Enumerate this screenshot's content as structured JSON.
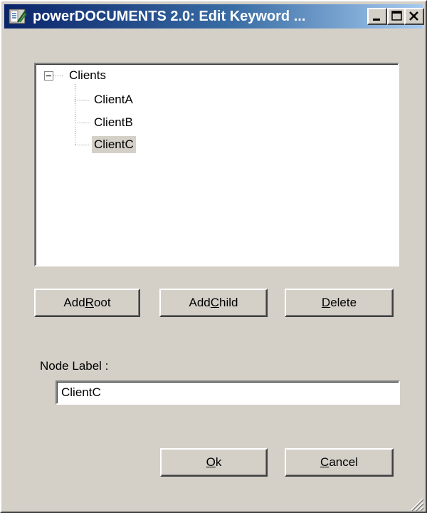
{
  "window": {
    "title": "powerDOCUMENTS 2.0: Edit Keyword ...",
    "caption_buttons": {
      "minimize_icon": "minimize-icon",
      "maximize_icon": "maximize-icon",
      "close_icon": "close-icon"
    }
  },
  "tree": {
    "root": {
      "label": "Clients",
      "expanded": true,
      "expander_glyph": "⊟"
    },
    "children": [
      {
        "label": "ClientA",
        "selected": false
      },
      {
        "label": "ClientB",
        "selected": false
      },
      {
        "label": "ClientC",
        "selected": true
      }
    ]
  },
  "buttons": {
    "add_root": {
      "pre": "Add",
      "mnemonic": "R",
      "post": "oot"
    },
    "add_child": {
      "pre": "Add",
      "mnemonic": "C",
      "post": "hild"
    },
    "delete": {
      "pre": "",
      "mnemonic": "D",
      "post": "elete"
    },
    "ok": {
      "pre": "",
      "mnemonic": "O",
      "post": "k"
    },
    "cancel": {
      "pre": "",
      "mnemonic": "C",
      "post": "ancel"
    }
  },
  "node_label": {
    "caption": "Node Label :",
    "value": "ClientC"
  },
  "colors": {
    "titlebar_start": "#0a246a",
    "titlebar_end": "#a6caf0",
    "face": "#d4d0c8",
    "selection_bg": "#d4d0c8"
  }
}
